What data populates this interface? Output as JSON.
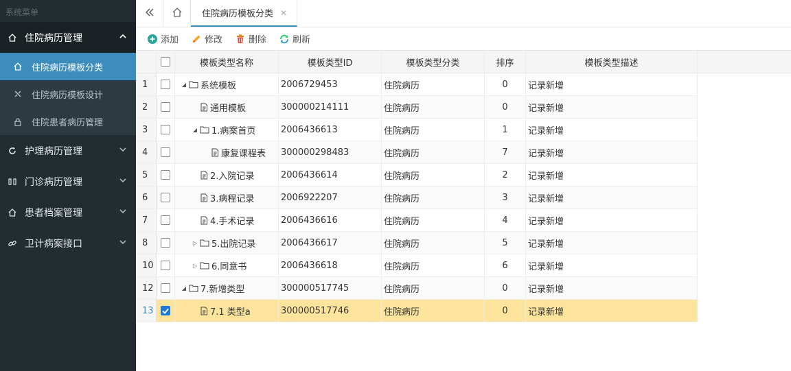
{
  "sidebar": {
    "title": "系统菜单",
    "groups": [
      {
        "label": "住院病历管理",
        "icon": "home-icon",
        "open": true,
        "items": [
          {
            "label": "住院病历模板分类",
            "icon": "home-icon",
            "active": true
          },
          {
            "label": "住院病历模板设计",
            "icon": "tools-icon",
            "active": false
          },
          {
            "label": "住院患者病历管理",
            "icon": "lock-icon",
            "active": false
          }
        ]
      },
      {
        "label": "护理病历管理",
        "icon": "refresh-icon",
        "open": false
      },
      {
        "label": "门诊病历管理",
        "icon": "columns-icon",
        "open": false
      },
      {
        "label": "患者档案管理",
        "icon": "home-icon",
        "open": false
      },
      {
        "label": "卫计病案接口",
        "icon": "link-icon",
        "open": false
      }
    ]
  },
  "tabs": [
    {
      "label": "住院病历模板分类"
    }
  ],
  "toolbar": {
    "add": "添加",
    "edit": "修改",
    "delete": "删除",
    "refresh": "刷新"
  },
  "table": {
    "headers": {
      "name": "模板类型名称",
      "id": "模板类型ID",
      "category": "模板类型分类",
      "sort": "排序",
      "desc": "模板类型描述"
    },
    "rows": [
      {
        "num": "1",
        "level": 0,
        "toggle": "expanded",
        "type": "folder",
        "name": "系统模板",
        "id": "2006729453",
        "category": "住院病历",
        "sort": "0",
        "desc": "记录新增",
        "checked": false
      },
      {
        "num": "2",
        "level": 1,
        "toggle": "none",
        "type": "file",
        "name": "通用模板",
        "id": "300000214111",
        "category": "住院病历",
        "sort": "0",
        "desc": "记录新增",
        "checked": false
      },
      {
        "num": "3",
        "level": 1,
        "toggle": "expanded",
        "type": "folder",
        "name": "1.病案首页",
        "id": "2006436613",
        "category": "住院病历",
        "sort": "1",
        "desc": "记录新增",
        "checked": false
      },
      {
        "num": "4",
        "level": 2,
        "toggle": "none",
        "type": "file",
        "name": "康复课程表",
        "id": "300000298483",
        "category": "住院病历",
        "sort": "7",
        "desc": "记录新增",
        "checked": false
      },
      {
        "num": "5",
        "level": 1,
        "toggle": "none",
        "type": "file",
        "name": "2.入院记录",
        "id": "2006436614",
        "category": "住院病历",
        "sort": "2",
        "desc": "记录新增",
        "checked": false
      },
      {
        "num": "6",
        "level": 1,
        "toggle": "none",
        "type": "file",
        "name": "3.病程记录",
        "id": "2006922207",
        "category": "住院病历",
        "sort": "3",
        "desc": "记录新增",
        "checked": false
      },
      {
        "num": "7",
        "level": 1,
        "toggle": "none",
        "type": "file",
        "name": "4.手术记录",
        "id": "2006436616",
        "category": "住院病历",
        "sort": "4",
        "desc": "记录新增",
        "checked": false
      },
      {
        "num": "8",
        "level": 1,
        "toggle": "collapsed",
        "type": "folder",
        "name": "5.出院记录",
        "id": "2006436617",
        "category": "住院病历",
        "sort": "5",
        "desc": "记录新增",
        "checked": false
      },
      {
        "num": "10",
        "level": 1,
        "toggle": "collapsed",
        "type": "folder",
        "name": "6.同意书",
        "id": "2006436618",
        "category": "住院病历",
        "sort": "6",
        "desc": "记录新增",
        "checked": false
      },
      {
        "num": "12",
        "level": 0,
        "toggle": "expanded",
        "type": "folder",
        "name": "7.新增类型",
        "id": "300000517745",
        "category": "住院病历",
        "sort": "0",
        "desc": "记录新增",
        "checked": false
      },
      {
        "num": "13",
        "level": 1,
        "toggle": "none",
        "type": "file",
        "name": "7.1 类型a",
        "id": "300000517746",
        "category": "住院病历",
        "sort": "0",
        "desc": "记录新增",
        "checked": true
      }
    ]
  },
  "colors": {
    "sidebar_bg": "#222d32",
    "active": "#3c8dbc",
    "selected_row": "#fce49c"
  }
}
